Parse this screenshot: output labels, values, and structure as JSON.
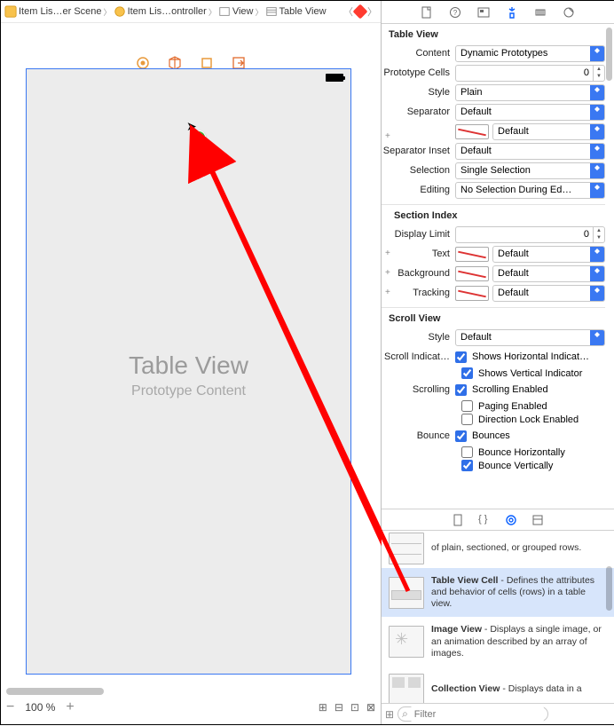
{
  "breadcrumb": {
    "items": [
      {
        "label": "Item Lis…er Scene"
      },
      {
        "label": "Item Lis…ontroller"
      },
      {
        "label": "View"
      },
      {
        "label": "Table View"
      }
    ]
  },
  "canvas": {
    "device_title": "Table View",
    "device_subtitle": "Prototype Content"
  },
  "zoom": {
    "value": "100 %"
  },
  "inspector": {
    "table_view": {
      "title": "Table View",
      "content_label": "Content",
      "content_value": "Dynamic Prototypes",
      "prototype_cells_label": "Prototype Cells",
      "prototype_cells_value": "0",
      "style_label": "Style",
      "style_value": "Plain",
      "separator_label": "Separator",
      "separator_value": "Default",
      "separator_color_value": "Default",
      "separator_inset_label": "Separator Inset",
      "separator_inset_value": "Default",
      "selection_label": "Selection",
      "selection_value": "Single Selection",
      "editing_label": "Editing",
      "editing_value": "No Selection During Ed…"
    },
    "section_index": {
      "title": "Section Index",
      "display_limit_label": "Display Limit",
      "display_limit_value": "0",
      "text_label": "Text",
      "text_value": "Default",
      "background_label": "Background",
      "background_value": "Default",
      "tracking_label": "Tracking",
      "tracking_value": "Default"
    },
    "scroll_view": {
      "title": "Scroll View",
      "style_label": "Style",
      "style_value": "Default",
      "scroll_indicat_label": "Scroll Indicat…",
      "shows_horizontal": "Shows Horizontal Indicat…",
      "shows_vertical": "Shows Vertical Indicator",
      "scrolling_label": "Scrolling",
      "scrolling_enabled": "Scrolling Enabled",
      "paging_enabled": "Paging Enabled",
      "direction_lock": "Direction Lock Enabled",
      "bounce_label": "Bounce",
      "bounces": "Bounces",
      "bounce_h": "Bounce Horizontally",
      "bounce_v": "Bounce Vertically"
    }
  },
  "library": {
    "items": [
      {
        "name": "",
        "desc": "of plain, sectioned, or grouped rows."
      },
      {
        "name": "Table View Cell",
        "desc": " - Defines the attributes and behavior of cells (rows) in a table view."
      },
      {
        "name": "Image View",
        "desc": " - Displays a single image, or an animation described by an array of images."
      },
      {
        "name": "Collection View",
        "desc": " - Displays data in a"
      }
    ],
    "filter_placeholder": "Filter"
  }
}
